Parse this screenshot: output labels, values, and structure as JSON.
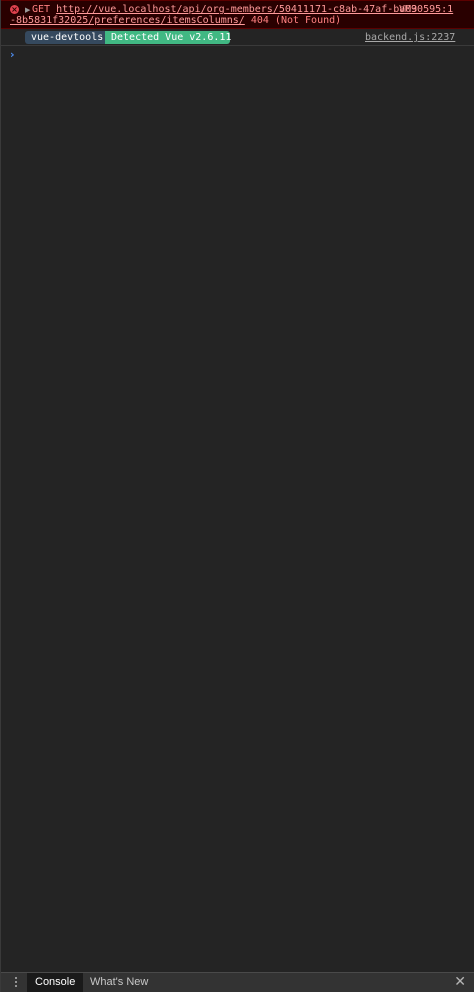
{
  "error_entry": {
    "icon": "error-circle-icon",
    "method": "GET",
    "url_line1": "http://vue.localhost/api/org-members/50411171-c8ab-47af-ba03",
    "url_line2": "-8b5831f32025/preferences/itemsColumns/",
    "status": "404 (Not Found)",
    "source": "VM90595:1"
  },
  "log_entry": {
    "badge_left": "vue-devtools",
    "badge_right": "Detected Vue v2.6.11",
    "source": "backend.js:2237"
  },
  "prompt": {
    "symbol": "›"
  },
  "drawer": {
    "tabs": [
      {
        "label": "Console",
        "active": true
      },
      {
        "label": "What's New",
        "active": false
      }
    ],
    "close_symbol": "✕"
  },
  "colors": {
    "background": "#242424",
    "error_background": "#290000",
    "error_text": "#ff8080",
    "vue_dark": "#35495e",
    "vue_green": "#41b883",
    "prompt_blue": "#4d8df0"
  }
}
